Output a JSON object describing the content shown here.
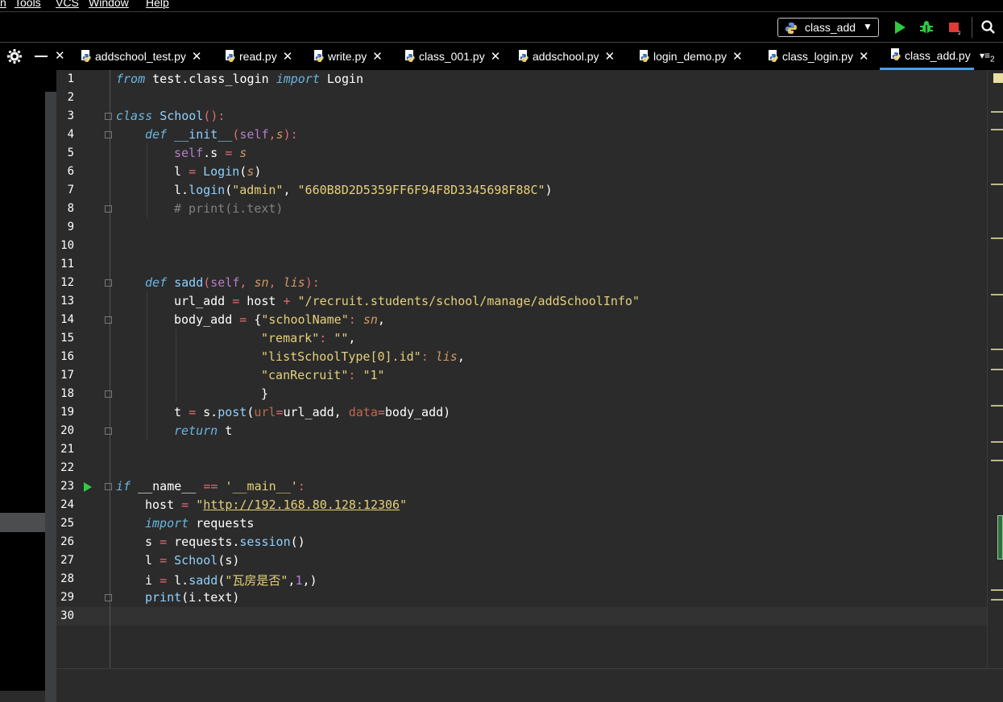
{
  "menu": {
    "items": [
      "n",
      "Tools",
      "VCS",
      "Window",
      "Help"
    ]
  },
  "toolbar": {
    "run_config": "class_add"
  },
  "tabs": [
    {
      "label": "addschool_test.py"
    },
    {
      "label": "read.py"
    },
    {
      "label": "write.py"
    },
    {
      "label": "class_001.py"
    },
    {
      "label": "addschool.py"
    },
    {
      "label": "login_demo.py"
    },
    {
      "label": "class_login.py"
    },
    {
      "label": "class_add.py"
    }
  ],
  "tab_overflow_count": "2",
  "line_numbers": [
    "1",
    "2",
    "3",
    "4",
    "5",
    "6",
    "7",
    "8",
    "9",
    "10",
    "11",
    "12",
    "13",
    "14",
    "15",
    "16",
    "17",
    "18",
    "19",
    "20",
    "21",
    "22",
    "23",
    "24",
    "25",
    "26",
    "27",
    "28",
    "29",
    "30"
  ],
  "code": {
    "l1": {
      "a": "from",
      "b": " test.class_login ",
      "c": "import",
      "d": " Login"
    },
    "l3": {
      "a": "class",
      "b": " ",
      "c": "School",
      "d": "():"
    },
    "l4": {
      "a": "def",
      "b": " ",
      "c": "__init__",
      "d": "(",
      "e": "self",
      ",": ",",
      "f": "s",
      "g": "):"
    },
    "l5": {
      "a": "self",
      ".": ".s ",
      "eq": "=",
      "sp": " ",
      "b": "s"
    },
    "l6": {
      "a": "l ",
      "eq": "=",
      "b": " ",
      "c": "Login",
      "d": "(",
      "e": "s",
      "f": ")"
    },
    "l7": {
      "a": "l.",
      "b": "login",
      "c": "(",
      "d": "\"admin\"",
      "e": ", ",
      "f": "\"660B8D2D5359FF6F94F8D3345698F88C\"",
      "g": ")"
    },
    "l8": {
      "a": "# print(i.text)"
    },
    "l12": {
      "a": "def",
      "b": " ",
      "c": "sadd",
      "d": "(",
      "e": "self",
      ",": ", ",
      "f": "sn",
      ",2": ", ",
      "g": "lis",
      "h": "):"
    },
    "l13": {
      "a": "url_add ",
      "eq": "=",
      "b": " host ",
      "plus": "+",
      "c": " ",
      "d": "\"/recruit.students/school/manage/addSchoolInfo\""
    },
    "l14": {
      "a": "body_add ",
      "eq": "=",
      "b": " {",
      "c": "\"schoolName\"",
      "d": ": ",
      "e": "sn",
      "f": ","
    },
    "l15": {
      "a": "\"remark\"",
      "b": ": ",
      "c": "\"\"",
      "d": ","
    },
    "l16": {
      "a": "\"listSchoolType[0].id\"",
      "b": ": ",
      "c": "lis",
      "d": ","
    },
    "l17": {
      "a": "\"canRecruit\"",
      "b": ": ",
      "c": "\"1\""
    },
    "l18": {
      "a": "}"
    },
    "l19": {
      "a": "t ",
      "eq": "=",
      "b": " s.",
      "c": "post",
      "d": "(",
      "e": "url",
      "f": "=",
      "g": "url_add, ",
      "h": "data",
      "i": "=",
      "j": "body_add)"
    },
    "l20": {
      "a": "return",
      "b": " t"
    },
    "l23": {
      "a": "if",
      "b": " __name__ ",
      "c": "==",
      "d": " ",
      "e": "'__main__'",
      "f": ":"
    },
    "l24": {
      "a": "host ",
      "eq": "=",
      "b": " ",
      "q1": "\"",
      "url": "http://192.168.80.128:12306",
      "q2": "\""
    },
    "l25": {
      "a": "import",
      "b": " requests"
    },
    "l26": {
      "a": "s ",
      "eq": "=",
      "b": " requests.",
      "c": "session",
      "d": "()"
    },
    "l27": {
      "a": "l ",
      "eq": "=",
      "b": " ",
      "c": "School",
      "d": "(s)"
    },
    "l28": {
      "a": "i ",
      "eq": "=",
      "b": " l.",
      "c": "sadd",
      "d": "(",
      "e": "\"瓦房是否\"",
      "f": ",",
      "g": "1",
      "h": ",)"
    },
    "l29": {
      "a": "print",
      "b": "(i.text)"
    }
  },
  "colors": {
    "accent": "#4a9ee8",
    "run": "#2ecc40",
    "stop": "#e53935"
  }
}
